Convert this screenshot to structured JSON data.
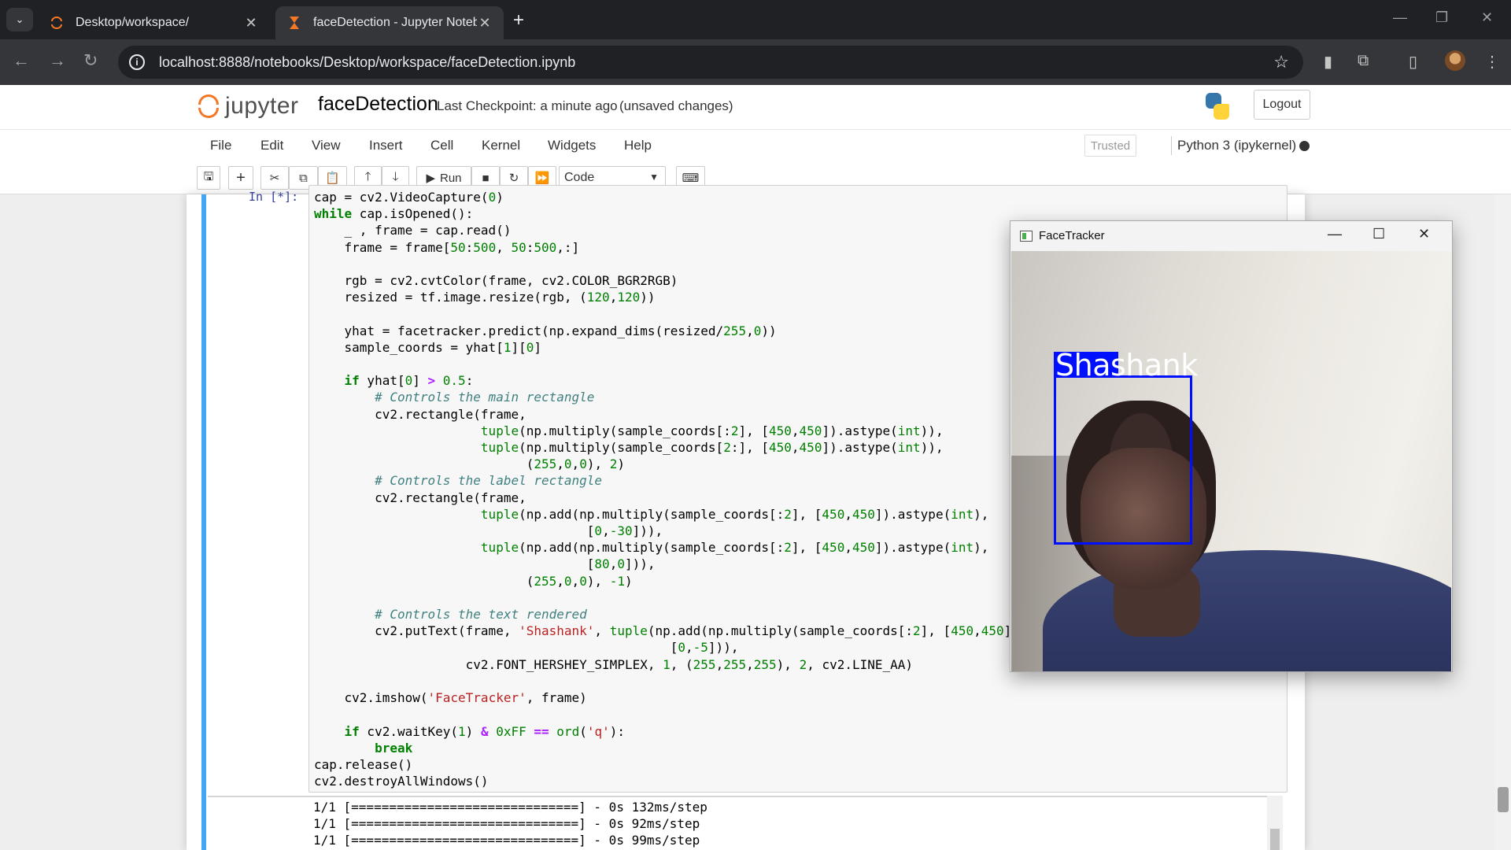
{
  "browser": {
    "tabs": [
      {
        "title": "Desktop/workspace/",
        "active": false
      },
      {
        "title": "faceDetection - Jupyter Notebook",
        "active": true
      }
    ],
    "url": "localhost:8888/notebooks/Desktop/workspace/faceDetection.ipynb"
  },
  "jupyter": {
    "logo_text": "jupyter",
    "notebook_name": "faceDetection",
    "checkpoint": "Last Checkpoint: a minute ago",
    "status": "(unsaved changes)",
    "logout": "Logout",
    "menu": [
      "File",
      "Edit",
      "View",
      "Insert",
      "Cell",
      "Kernel",
      "Widgets",
      "Help"
    ],
    "trusted": "Trusted",
    "kernel": "Python 3 (ipykernel)",
    "toolbar": {
      "run_label": "Run",
      "cell_type": "Code"
    }
  },
  "cell": {
    "prompt": "In [*]:",
    "output_lines": [
      "1/1 [==============================] - 0s 132ms/step",
      "1/1 [==============================] - 0s 92ms/step",
      "1/1 [==============================] - 0s 99ms/step"
    ]
  },
  "facetracker": {
    "title": "FaceTracker",
    "label": "Shashank"
  },
  "colors": {
    "accent": "#42a5f5",
    "jupyter_orange": "#f37726",
    "box_blue": "#0010ff"
  }
}
